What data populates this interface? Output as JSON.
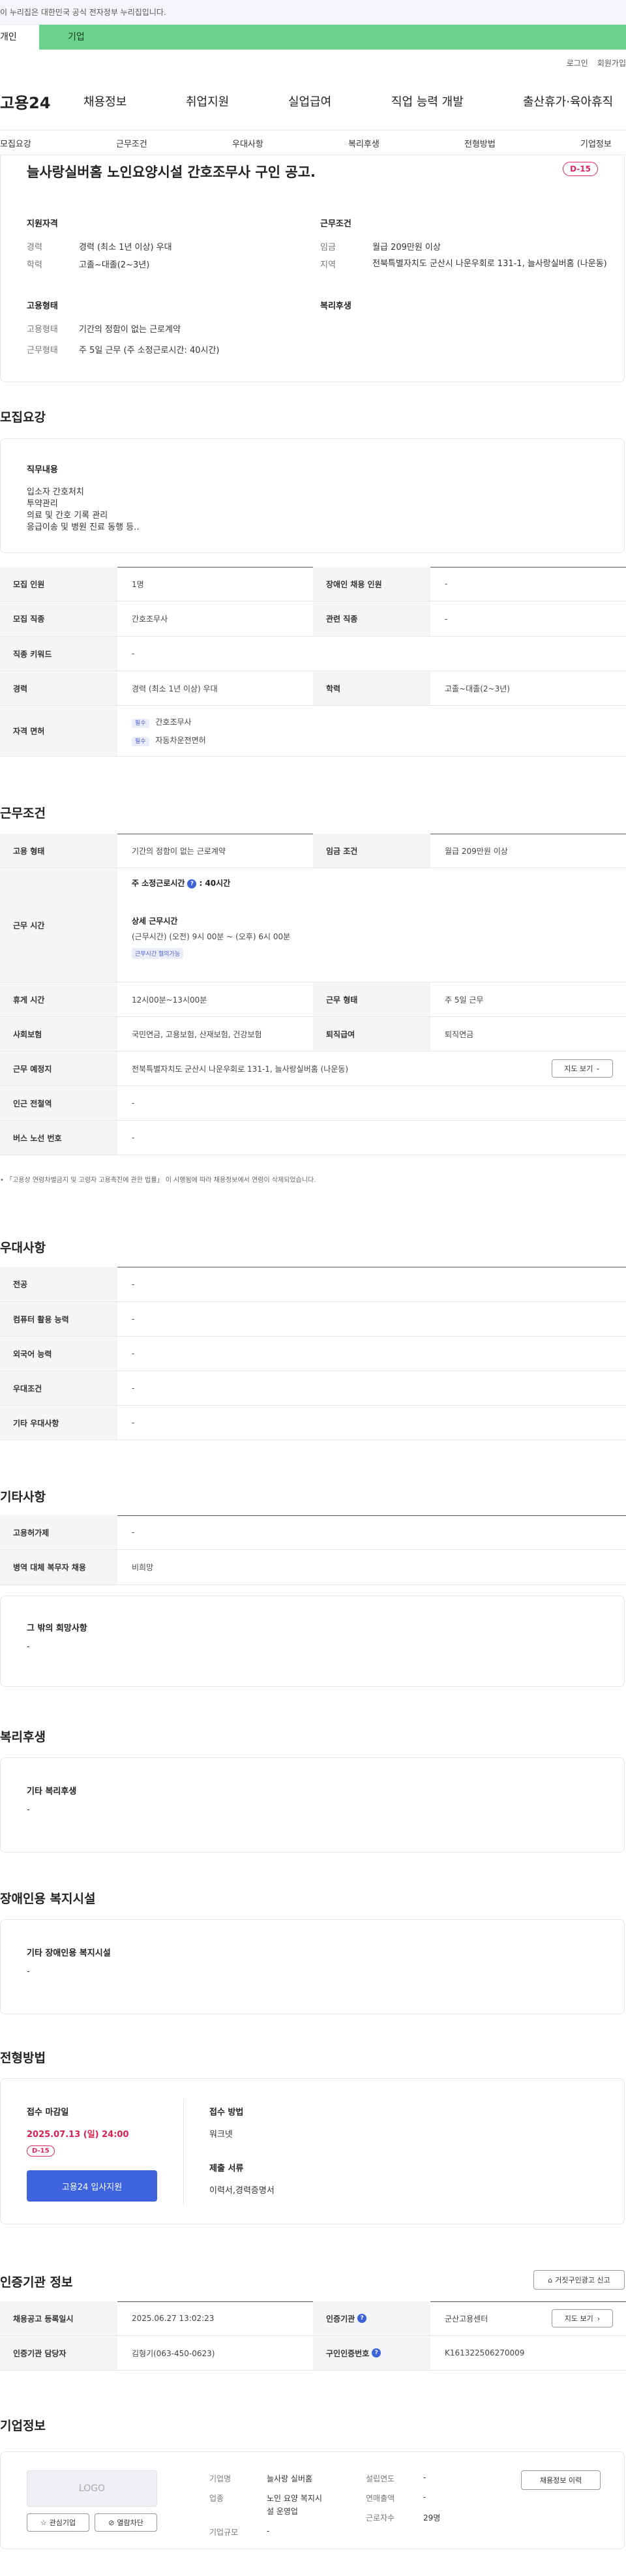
{
  "topbar": {
    "notice": "이 누리집은 대한민국 공식 전자정부 누리집입니다."
  },
  "user_tabs": {
    "individual": "개인",
    "business": "기업"
  },
  "util": {
    "login": "로그인",
    "signup": "회원가입"
  },
  "logo": "고용24",
  "gnb": [
    "채용정보",
    "취업지원",
    "실업급여",
    "직업 능력 개발",
    "출산휴가·육아휴직"
  ],
  "subtabs": [
    "모집요강",
    "근무조건",
    "우대사항",
    "복리후생",
    "전형방법",
    "기업정보"
  ],
  "header": {
    "title": "늘사랑실버홈 노인요양시설 간호조무사 구인 공고.",
    "dday": "D-15",
    "qual_title": "지원자격",
    "qual": [
      {
        "k": "경력",
        "v": "경력 (최소 1년 이상) 우대"
      },
      {
        "k": "학력",
        "v": "고졸~대졸(2~3년)"
      }
    ],
    "emp_title": "고용형태",
    "emp": [
      {
        "k": "고용형태",
        "v": "기간의 정함이 없는 근로계약"
      },
      {
        "k": "근무형태",
        "v": "주 5일 근무 (주 소정근로시간: 40시간)"
      }
    ],
    "cond_title": "근무조건",
    "cond": [
      {
        "k": "임금",
        "v": "월급 209만원 이상"
      },
      {
        "k": "지역",
        "v": "전북특별자치도 군산시 나운우회로 131-1, 늘사랑실버홈 (나운동)"
      }
    ],
    "welfare_title": "복리후생"
  },
  "recruit": {
    "title": "모집요강",
    "duty_title": "직무내용",
    "duty_lines": [
      "입소자 간호처치",
      "투약관리",
      "의료 및 간호 기록 관리",
      "응급이송 및 병원 진료 동행 등.."
    ],
    "rows": [
      {
        "k1": "모집 인원",
        "v1": "1명",
        "k2": "장애인 채용 인원",
        "v2": "-"
      },
      {
        "k1": "모집 직종",
        "v1": "간호조무사",
        "k2": "관련 직종",
        "v2": "-"
      },
      {
        "k1": "직종 키워드",
        "v1": "-"
      },
      {
        "k1": "경력",
        "v1": "경력 (최소 1년 이상) 우대",
        "k2": "학력",
        "v2": "고졸~대졸(2~3년)"
      }
    ],
    "license_k": "자격 면허",
    "licenses": [
      {
        "tag": "필수",
        "name": "간호조무사"
      },
      {
        "tag": "필수",
        "name": "자동차운전면허"
      }
    ]
  },
  "work": {
    "title": "근무조건",
    "emp_k": "고용 형태",
    "emp_v": "기간의 정함이 없는 근로계약",
    "wage_k": "임금 조건",
    "wage_v": "월급 209만원 이상",
    "hours_k": "근무 시간",
    "hours_main": "주 소정근로시간",
    "hours_main_v": ": 40시간",
    "hours_detail_title": "상세 근무시간",
    "hours_detail": "(근무시간) (오전) 9시 00분 ~ (오후) 6시 00분",
    "hours_tag": "근무시간 협의가능",
    "rows": [
      {
        "k1": "휴게 시간",
        "v1": "12시00분~13시00분",
        "k2": "근무 형태",
        "v2": "주 5일 근무"
      },
      {
        "k1": "사회보험",
        "v1": "국민연금, 고용보험, 산재보험, 건강보험",
        "k2": "퇴직급여",
        "v2": "퇴직연금"
      }
    ],
    "place_k": "근무 예정지",
    "place_v": "전북특별자치도 군산시 나운우회로 131-1, 늘사랑실버홈 (나운동)",
    "map_btn": "지도 보기",
    "station_k": "인근 전철역",
    "station_v": "-",
    "bus_k": "버스 노선 번호",
    "bus_v": "-",
    "note": "「고용상 연령차별금지 및 고령자 고용촉진에 관한 법률」 이 시행됨에 따라 채용정보에서 연령이 삭제되었습니다."
  },
  "pref": {
    "title": "우대사항",
    "rows": [
      {
        "k": "전공",
        "v": "-"
      },
      {
        "k": "컴퓨터 활용 능력",
        "v": "-"
      },
      {
        "k": "외국어 능력",
        "v": "-"
      },
      {
        "k": "우대조건",
        "v": "-"
      },
      {
        "k": "기타 우대사항",
        "v": "-"
      }
    ]
  },
  "etc": {
    "title": "기타사항",
    "rows": [
      {
        "k": "고용허가제",
        "v": "-"
      },
      {
        "k": "병역 대체 복무자 채용",
        "v": "비희망"
      }
    ],
    "other_title": "그 밖의 희망사항",
    "other_v": "-"
  },
  "welfare": {
    "title": "복리후생",
    "box_title": "기타 복리후생",
    "box_v": "-"
  },
  "disabled": {
    "title": "장애인용 복지시설",
    "box_title": "기타 장애인용 복지시설",
    "box_v": "-"
  },
  "apply": {
    "title": "전형방법",
    "deadline_k": "접수 마감일",
    "deadline_v": "2025.07.13 (일) 24:00",
    "dday": "D-15",
    "apply_btn": "고용24 입사지원",
    "method_k": "접수 방법",
    "method_v": "워크넷",
    "docs_k": "제출 서류",
    "docs_v": "이력서,경력증명서"
  },
  "agency": {
    "title": "인증기관 정보",
    "report_btn": "거짓구인광고 신고",
    "rows": [
      {
        "k1": "채용공고 등록일시",
        "v1": "2025.06.27 13:02:23",
        "k2": "인증기관",
        "v2": "군산고용센터",
        "btn": "지도 보기"
      },
      {
        "k1": "인증기관 담당자",
        "v1": "김형기(063-450-0623)",
        "k2": "구인인증번호",
        "v2": "K161322506270009"
      }
    ]
  },
  "company": {
    "title": "기업정보",
    "logo": "LOGO",
    "fav_btn": "관심기업",
    "block_btn": "열람차단",
    "name_k": "기업명",
    "name_v": "늘사랑 실버홈",
    "ind_k": "업종",
    "ind_v1": "노인 요양 복지시",
    "ind_v2": "설 운영업",
    "size_k": "기업규모",
    "size_v": "-",
    "est_k": "설립연도",
    "est_v": "-",
    "sales_k": "연매출액",
    "sales_v": "-",
    "emp_k": "근로자수",
    "emp_v": "29명",
    "hist_btn": "채용정보 이력"
  }
}
